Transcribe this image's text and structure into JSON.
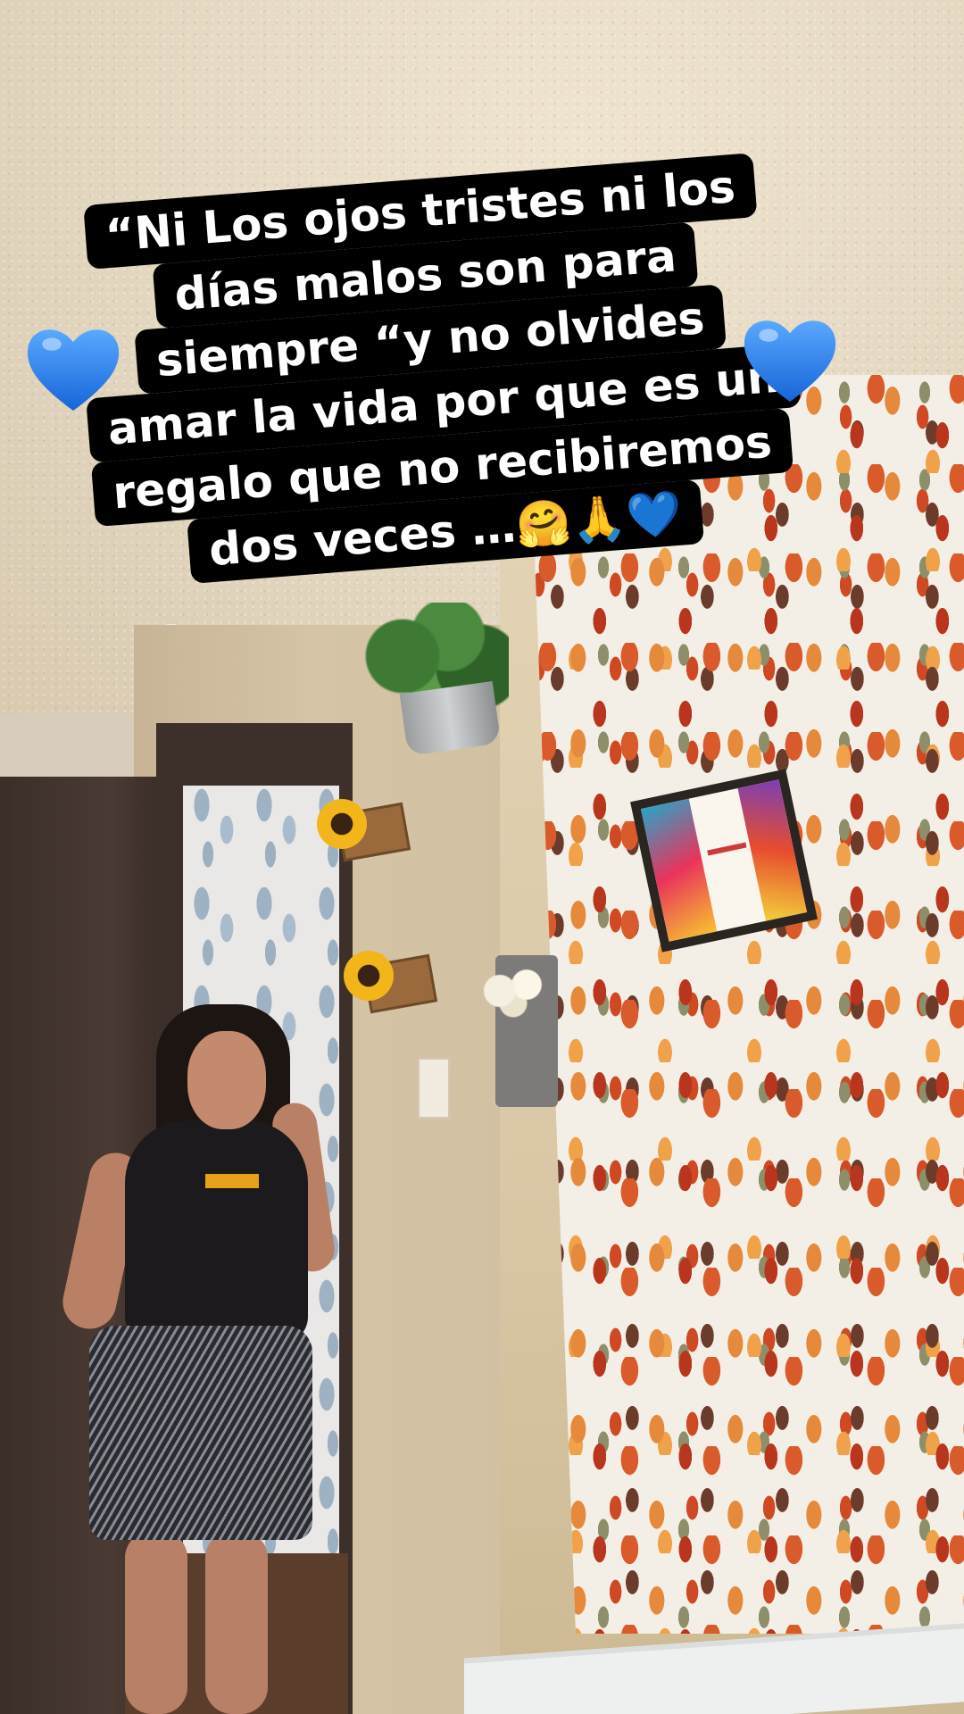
{
  "caption": {
    "lines": [
      "“Ni Los ojos tristes ni los",
      "días malos son para",
      "siempre “y no olvides",
      "amar la vida por que es un",
      "regalo que no recibiremos",
      "dos veces …🤗🙏💙"
    ]
  },
  "stickers": [
    {
      "name": "blue-heart-left",
      "emoji": "blue-heart"
    },
    {
      "name": "blue-heart-right",
      "emoji": "blue-heart"
    }
  ],
  "colors": {
    "caption_bg": "#000000",
    "caption_text": "#ffffff",
    "heart_blue": "#1f7bf2"
  }
}
